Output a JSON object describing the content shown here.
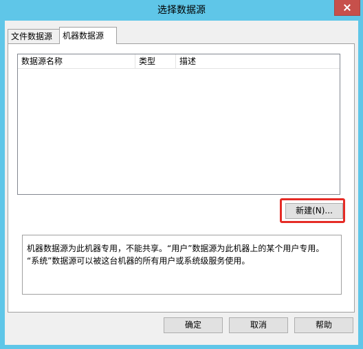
{
  "window": {
    "title": "选择数据源"
  },
  "tabs": [
    {
      "label": "文件数据源"
    },
    {
      "label": "机器数据源"
    }
  ],
  "list": {
    "columns": [
      "数据源名称",
      "类型",
      "描述"
    ],
    "rows": []
  },
  "buttons": {
    "new": "新建(N)...",
    "ok": "确定",
    "cancel": "取消",
    "help": "帮助"
  },
  "info": {
    "line1": "机器数据源为此机器专用，不能共享。“用户”数据源为此机器上的某个用户专用。",
    "line2": "“系统”数据源可以被这台机器的所有用户或系统级服务使用。"
  },
  "colors": {
    "titlebar": "#5fc6e8",
    "highlight_frame": "#e52b25"
  }
}
